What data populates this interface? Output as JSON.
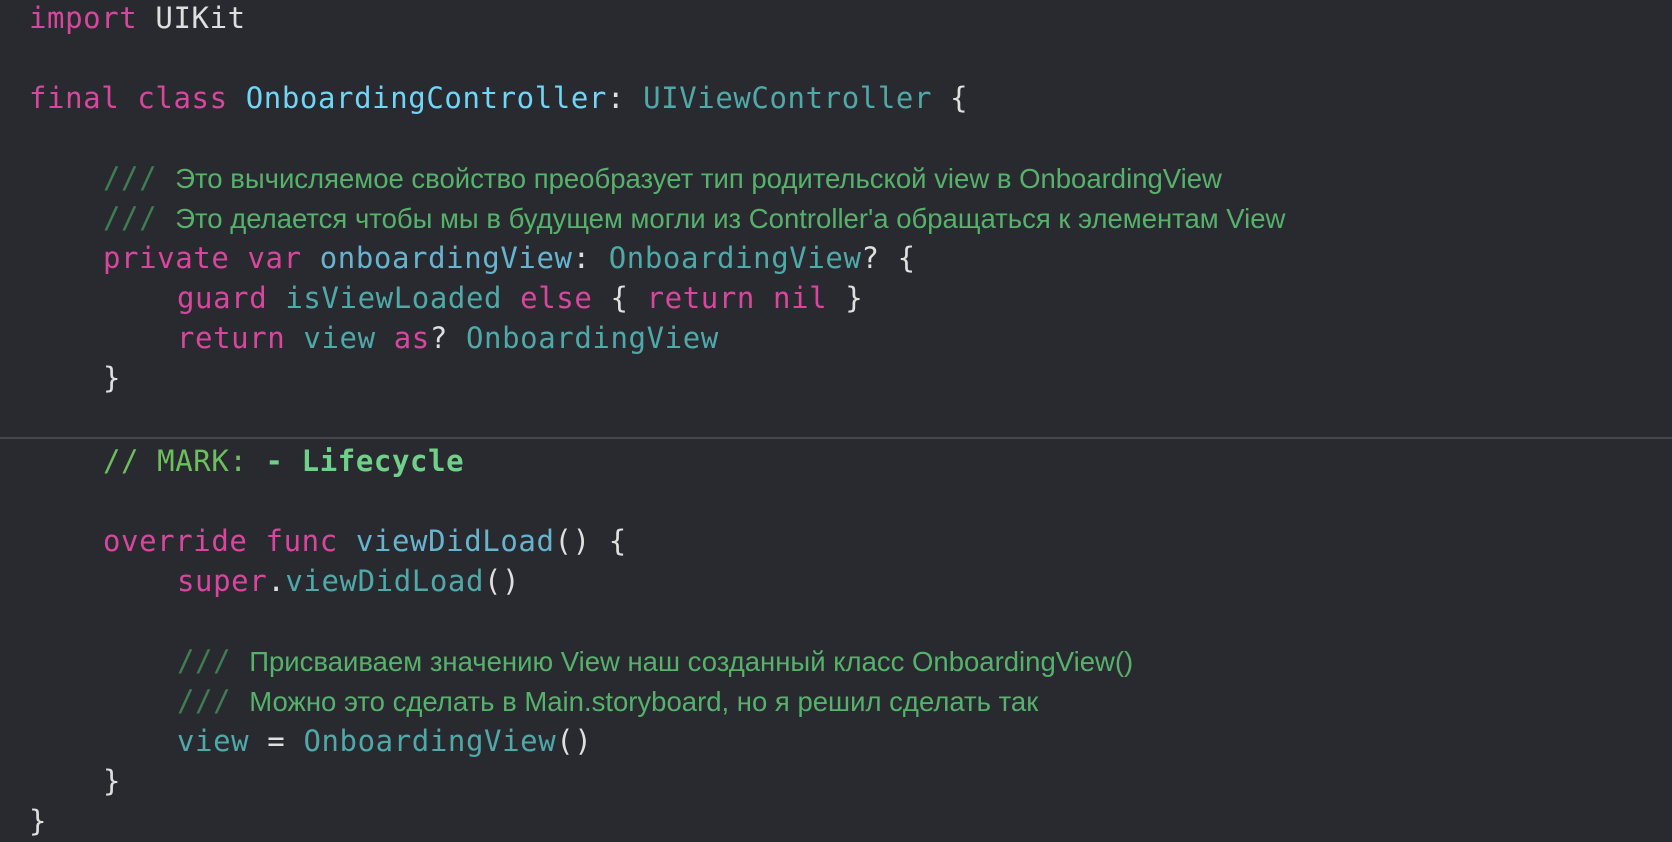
{
  "colors": {
    "background": "#292a30",
    "keyword": "#d8469e",
    "comment": "#56b26b"
  },
  "lines": [
    {
      "indent": 0,
      "tokens": [
        {
          "t": "import",
          "c": "kw"
        },
        {
          "t": " UIKit",
          "c": "plain"
        }
      ]
    },
    {
      "indent": 0,
      "tokens": []
    },
    {
      "indent": 0,
      "tokens": [
        {
          "t": "final",
          "c": "kw"
        },
        {
          "t": " ",
          "c": "plain"
        },
        {
          "t": "class",
          "c": "kw"
        },
        {
          "t": " ",
          "c": "plain"
        },
        {
          "t": "OnboardingController",
          "c": "decl"
        },
        {
          "t": ": ",
          "c": "plain"
        },
        {
          "t": "UIViewController",
          "c": "type"
        },
        {
          "t": " {",
          "c": "plain"
        }
      ]
    },
    {
      "indent": 0,
      "tokens": []
    },
    {
      "indent": 1,
      "tokens": [
        {
          "t": "/// ",
          "c": "docslash"
        },
        {
          "t": "Это вычисляемое свойство преобразует тип родительской view в OnboardingView",
          "c": "doc"
        }
      ]
    },
    {
      "indent": 1,
      "tokens": [
        {
          "t": "/// ",
          "c": "docslash"
        },
        {
          "t": "Это делается чтобы мы в будущем могли из Controller'a обращаться к элементам View",
          "c": "doc"
        }
      ]
    },
    {
      "indent": 1,
      "tokens": [
        {
          "t": "private",
          "c": "kw"
        },
        {
          "t": " ",
          "c": "plain"
        },
        {
          "t": "var",
          "c": "kw"
        },
        {
          "t": " ",
          "c": "plain"
        },
        {
          "t": "onboardingView",
          "c": "decl2"
        },
        {
          "t": ": ",
          "c": "plain"
        },
        {
          "t": "OnboardingView",
          "c": "type"
        },
        {
          "t": "? {",
          "c": "plain"
        }
      ]
    },
    {
      "indent": 2,
      "tokens": [
        {
          "t": "guard",
          "c": "kw"
        },
        {
          "t": " ",
          "c": "plain"
        },
        {
          "t": "isViewLoaded",
          "c": "fn"
        },
        {
          "t": " ",
          "c": "plain"
        },
        {
          "t": "else",
          "c": "kw"
        },
        {
          "t": " { ",
          "c": "plain"
        },
        {
          "t": "return",
          "c": "kw"
        },
        {
          "t": " ",
          "c": "plain"
        },
        {
          "t": "nil",
          "c": "kw"
        },
        {
          "t": " }",
          "c": "plain"
        }
      ]
    },
    {
      "indent": 2,
      "tokens": [
        {
          "t": "return",
          "c": "kw"
        },
        {
          "t": " ",
          "c": "plain"
        },
        {
          "t": "view",
          "c": "fn"
        },
        {
          "t": " ",
          "c": "plain"
        },
        {
          "t": "as",
          "c": "kw"
        },
        {
          "t": "? ",
          "c": "plain"
        },
        {
          "t": "OnboardingView",
          "c": "type"
        }
      ]
    },
    {
      "indent": 1,
      "tokens": [
        {
          "t": "}",
          "c": "plain"
        }
      ]
    },
    {
      "indent": 0,
      "tokens": []
    },
    {
      "indent": 1,
      "tokens": [
        {
          "t": "// MARK: ",
          "c": "cmt"
        },
        {
          "t": "- Lifecycle",
          "c": "mark"
        }
      ]
    },
    {
      "indent": 0,
      "tokens": []
    },
    {
      "indent": 1,
      "tokens": [
        {
          "t": "override",
          "c": "kw"
        },
        {
          "t": " ",
          "c": "plain"
        },
        {
          "t": "func",
          "c": "kw"
        },
        {
          "t": " ",
          "c": "plain"
        },
        {
          "t": "viewDidLoad",
          "c": "decl2"
        },
        {
          "t": "() {",
          "c": "plain"
        }
      ]
    },
    {
      "indent": 2,
      "tokens": [
        {
          "t": "super",
          "c": "kw"
        },
        {
          "t": ".",
          "c": "plain"
        },
        {
          "t": "viewDidLoad",
          "c": "fn"
        },
        {
          "t": "()",
          "c": "plain"
        }
      ]
    },
    {
      "indent": 0,
      "tokens": []
    },
    {
      "indent": 2,
      "tokens": [
        {
          "t": "/// ",
          "c": "docslash"
        },
        {
          "t": "Присваиваем значению View наш созданный класс OnboardingView()",
          "c": "doc"
        }
      ]
    },
    {
      "indent": 2,
      "tokens": [
        {
          "t": "/// ",
          "c": "docslash"
        },
        {
          "t": "Можно это сделать в Main.storyboard, но я решил сделать так",
          "c": "doc"
        }
      ]
    },
    {
      "indent": 2,
      "tokens": [
        {
          "t": "view",
          "c": "fn"
        },
        {
          "t": " = ",
          "c": "plain"
        },
        {
          "t": "OnboardingView",
          "c": "type"
        },
        {
          "t": "()",
          "c": "plain"
        }
      ]
    },
    {
      "indent": 1,
      "tokens": [
        {
          "t": "}",
          "c": "plain"
        }
      ]
    },
    {
      "indent": 0,
      "tokens": [
        {
          "t": "}",
          "c": "plain"
        }
      ]
    }
  ]
}
